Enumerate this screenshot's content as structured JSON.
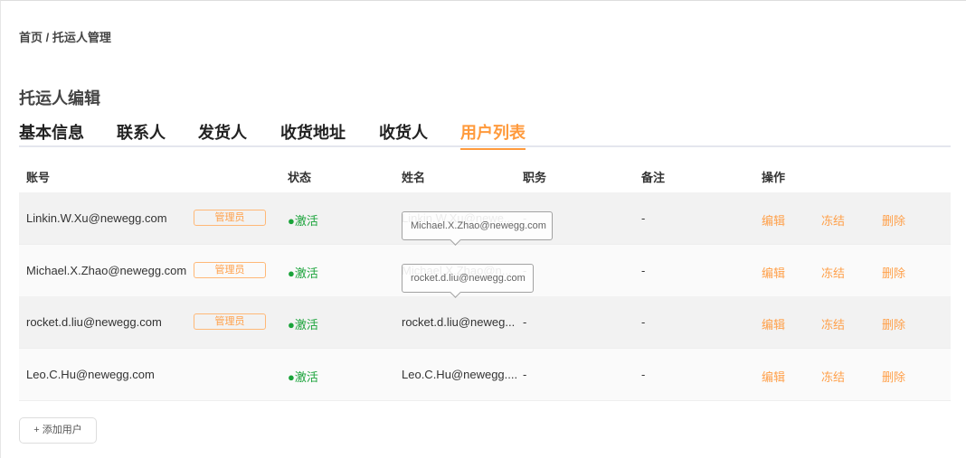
{
  "breadcrumb": "首页 / 托运人管理",
  "title": "托运人编辑",
  "tabs": [
    "基本信息",
    "联系人",
    "发货人",
    "收货地址",
    "收货人",
    "用户列表"
  ],
  "columns": [
    "账号",
    "状态",
    "姓名",
    "职务",
    "备注",
    "操作"
  ],
  "rows": [
    {
      "account": "Linkin.W.Xu@newegg.com",
      "badge": "管理员",
      "status": "●激活",
      "name": "Linkin.W.Xu@newe...",
      "position": "-",
      "remark": "-"
    },
    {
      "account": "Michael.X.Zhao@newegg.com",
      "badge": "管理员",
      "status": "●激活",
      "name": "Michael.X.Zhao@n...",
      "position": "-",
      "remark": "-"
    },
    {
      "account": "rocket.d.liu@newegg.com",
      "badge": "管理员",
      "status": "●激活",
      "name": "rocket.d.liu@neweg...",
      "position": "-",
      "remark": "-"
    },
    {
      "account": "Leo.C.Hu@newegg.com",
      "badge": "",
      "status": "●激活",
      "name": "Leo.C.Hu@newegg....",
      "position": "-",
      "remark": "-"
    }
  ],
  "actions": {
    "edit": "编辑",
    "freeze": "冻结",
    "delete": "删除"
  },
  "tooltips": [
    "Michael.X.Zhao@newegg.com",
    "rocket.d.liu@newegg.com"
  ],
  "add_button": "+ 添加用户"
}
